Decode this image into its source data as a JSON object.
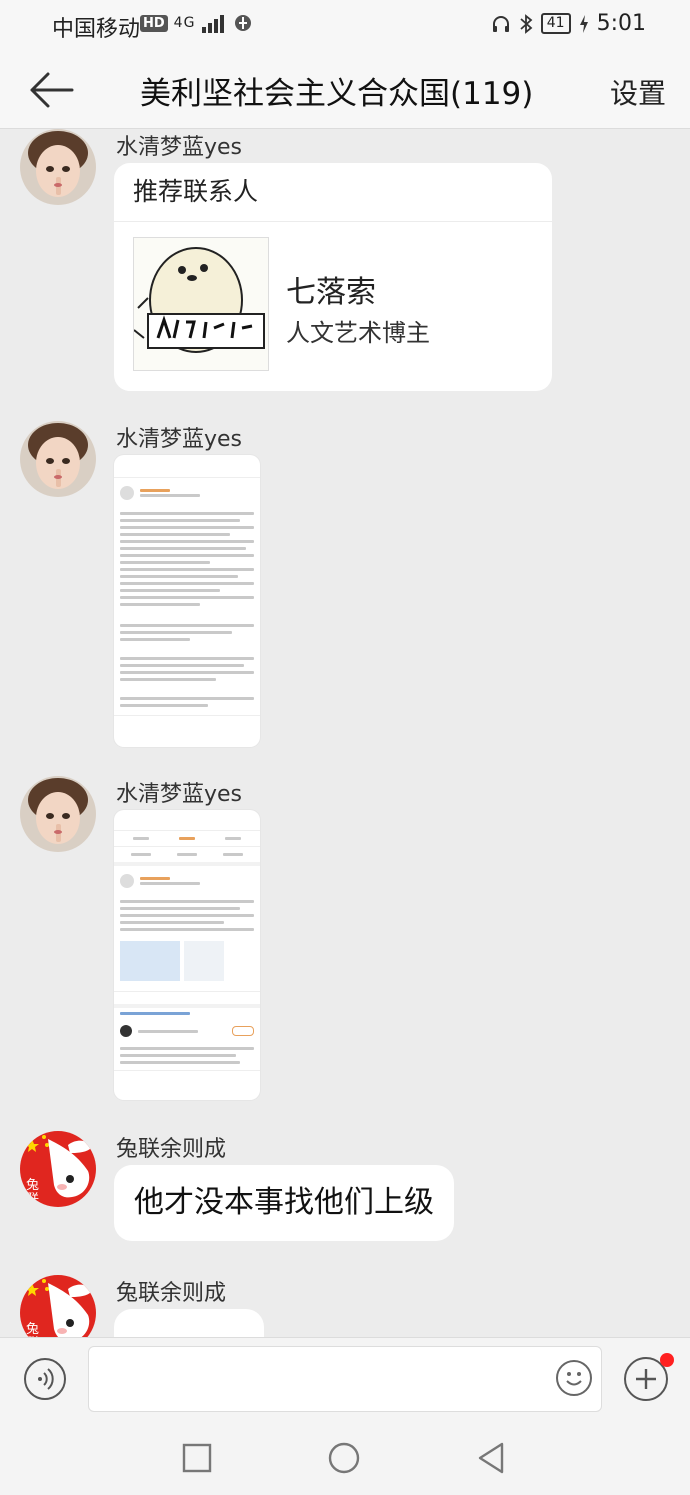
{
  "status_bar": {
    "carrier": "中国移动",
    "hd": "HD",
    "network": "4G",
    "battery": "41",
    "time": "5:01"
  },
  "header": {
    "title": "美利坚社会主义合众国(119)",
    "settings_label": "设置",
    "back_icon": "arrow-left-icon"
  },
  "messages": [
    {
      "sender": "水清梦蓝yes",
      "type": "contact_card",
      "card_title": "推荐联系人",
      "contact_name": "七落索",
      "contact_desc": "人文艺术博主"
    },
    {
      "sender": "水清梦蓝yes",
      "type": "image"
    },
    {
      "sender": "水清梦蓝yes",
      "type": "image"
    },
    {
      "sender": "兔联余则成",
      "type": "text",
      "text": "他才没本事找他们上级"
    },
    {
      "sender": "兔联余则成",
      "type": "text",
      "text": ""
    }
  ],
  "input_bar": {
    "voice_icon": "voice-icon",
    "emoji_icon": "emoji-icon",
    "plus_icon": "plus-icon",
    "has_notification_dot": true
  },
  "nav_bar": {
    "icons": [
      "square-icon",
      "circle-icon",
      "triangle-back-icon"
    ]
  },
  "colors": {
    "background": "#ececec",
    "bubble": "#ffffff",
    "notification_dot": "#ff2020",
    "avatar_red": "#e0261f"
  }
}
